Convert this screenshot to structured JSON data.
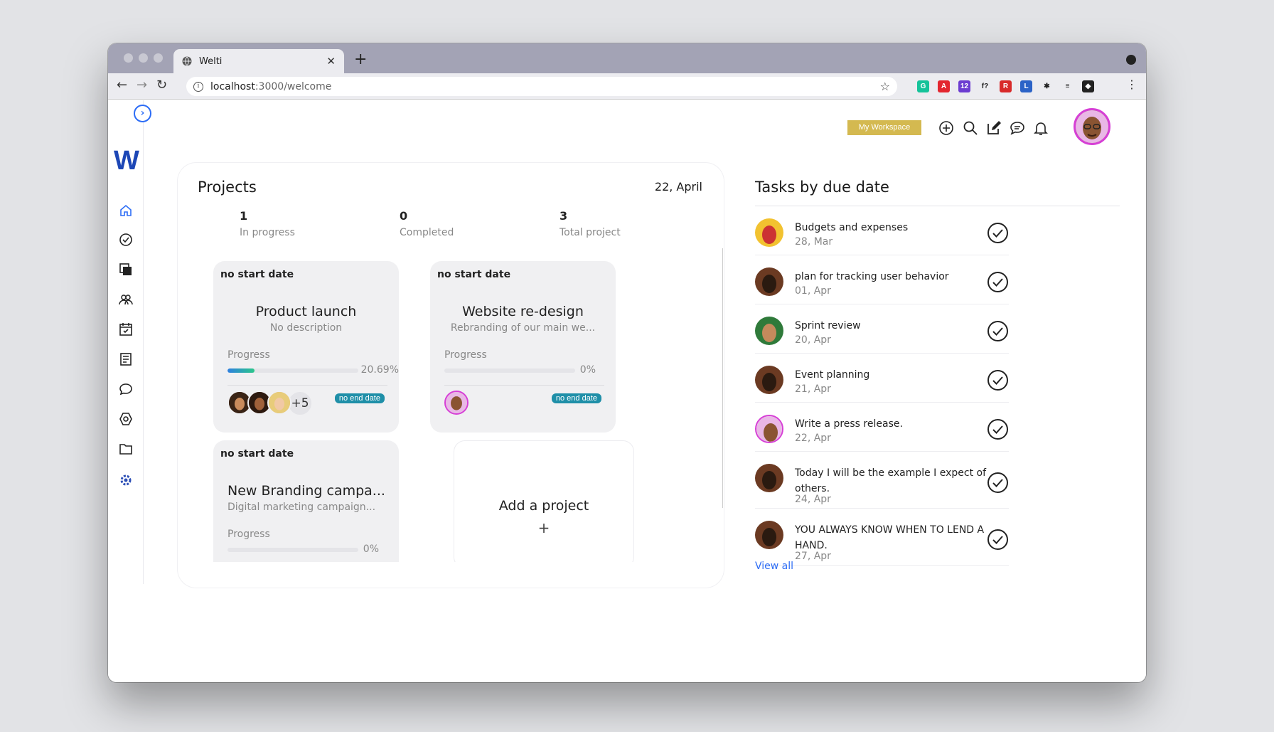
{
  "browser": {
    "tab_title": "Welti",
    "new_tab": "+",
    "url_host": "localhost",
    "url_path": ":3000/welcome",
    "extensions": [
      {
        "name": "grammarly-icon",
        "color": "#15c39a",
        "label": "G"
      },
      {
        "name": "pdf-icon",
        "color": "#e3262f",
        "label": "A"
      },
      {
        "name": "badge-ext-icon",
        "color": "#6c3cd1",
        "label": "12"
      },
      {
        "name": "font-ext-icon",
        "color": "#ffffff",
        "label": "f?"
      },
      {
        "name": "red-ext-icon",
        "color": "#d82a2a",
        "label": "R"
      },
      {
        "name": "blue-ext-icon",
        "color": "#2b63c7",
        "label": "L"
      },
      {
        "name": "puzzle-icon",
        "color": "#ffffff",
        "label": "✱"
      },
      {
        "name": "playlist-icon",
        "color": "#ffffff",
        "label": "≡"
      },
      {
        "name": "profile-icon",
        "color": "#222222",
        "label": "◆"
      }
    ]
  },
  "header": {
    "workspace_label": "My Workspace",
    "accent": "#d4b950"
  },
  "projects": {
    "title": "Projects",
    "date": "22, April",
    "stats": [
      {
        "value": "1",
        "label": "In progress"
      },
      {
        "value": "0",
        "label": "Completed"
      },
      {
        "value": "3",
        "label": "Total project"
      }
    ],
    "cards": [
      {
        "start": "no start date",
        "name": "Product launch",
        "description": "No description",
        "progress_label": "Progress",
        "progress": 20.69,
        "progress_text": "20.69%",
        "end_tag": "no end date",
        "more_members": "+5"
      },
      {
        "start": "no start date",
        "name": "Website re-design",
        "description": "Rebranding of our main we...",
        "progress_label": "Progress",
        "progress": 0,
        "progress_text": "0%",
        "end_tag": "no end date"
      },
      {
        "start": "no start date",
        "name": "New Branding campa...",
        "description": "Digital marketing campaign...",
        "progress_label": "Progress",
        "progress": 0,
        "progress_text": "0%"
      }
    ],
    "add_project": {
      "label": "Add a project",
      "icon": "+"
    }
  },
  "tasks": {
    "title": "Tasks by due date",
    "items": [
      {
        "name": "Budgets and expenses",
        "date": "28, Mar"
      },
      {
        "name": "plan for tracking user behavior",
        "date": "01, Apr"
      },
      {
        "name": "Sprint review",
        "date": "20, Apr"
      },
      {
        "name": "Event planning",
        "date": "21, Apr"
      },
      {
        "name": "Write a press release.",
        "date": "22, Apr"
      },
      {
        "name": "Today I will be the example I expect of others.",
        "date": "24, Apr"
      },
      {
        "name": "YOU ALWAYS KNOW WHEN TO LEND A HAND.",
        "date": "27, Apr"
      }
    ],
    "view_all": "View all"
  }
}
